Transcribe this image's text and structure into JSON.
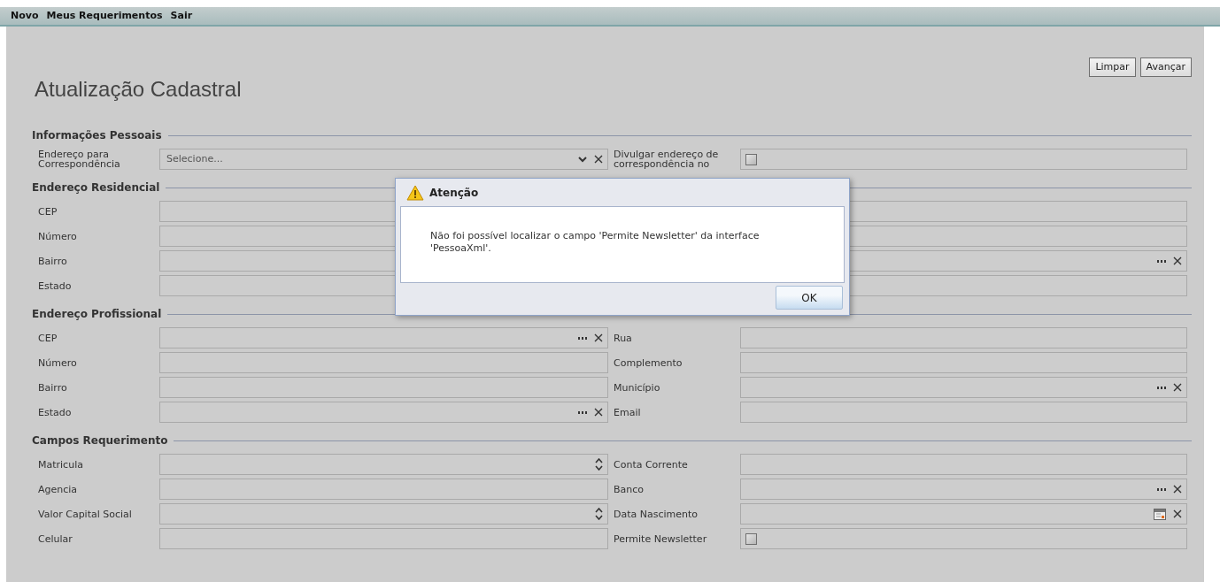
{
  "menu": [
    {
      "label": "Novo"
    },
    {
      "label": "Meus Requerimentos"
    },
    {
      "label": "Sair"
    }
  ],
  "buttons": [
    "Limpar",
    "Avançar"
  ],
  "title": "Atualização Cadastral",
  "sections": [
    {
      "title": "Informações Pessoais",
      "rows": [
        {
          "left": {
            "label": "Endereço para Correspondência",
            "kind": "select",
            "placeholder": "Selecione..."
          },
          "right": {
            "label": "Divulgar endereço de correspondência no",
            "kind": "checkbox",
            "checked": false
          }
        }
      ]
    },
    {
      "title": "Endereço Residencial",
      "rows": [
        {
          "left": {
            "label": "CEP",
            "kind": "text"
          },
          "right": {
            "kind": "text"
          }
        },
        {
          "left": {
            "label": "Número",
            "kind": "text"
          },
          "right": {
            "kind": "text"
          }
        },
        {
          "left": {
            "label": "Bairro",
            "kind": "text"
          },
          "right": {
            "kind": "lookup"
          }
        },
        {
          "left": {
            "label": "Estado",
            "kind": "text"
          },
          "right": {
            "kind": "text"
          }
        }
      ]
    },
    {
      "title": "Endereço Profissional",
      "rows": [
        {
          "left": {
            "label": "CEP",
            "kind": "lookup"
          },
          "right": {
            "label": "Rua",
            "kind": "text"
          }
        },
        {
          "left": {
            "label": "Número",
            "kind": "text"
          },
          "right": {
            "label": "Complemento",
            "kind": "text"
          }
        },
        {
          "left": {
            "label": "Bairro",
            "kind": "text"
          },
          "right": {
            "label": "Município",
            "kind": "lookup"
          }
        },
        {
          "left": {
            "label": "Estado",
            "kind": "lookup"
          },
          "right": {
            "label": "Email",
            "kind": "text"
          }
        }
      ]
    },
    {
      "title": "Campos Requerimento",
      "rows": [
        {
          "left": {
            "label": "Matricula",
            "kind": "spin"
          },
          "right": {
            "label": "Conta Corrente",
            "kind": "text"
          }
        },
        {
          "left": {
            "label": "Agencia",
            "kind": "text"
          },
          "right": {
            "label": "Banco",
            "kind": "lookup"
          }
        },
        {
          "left": {
            "label": "Valor Capital Social",
            "kind": "spin"
          },
          "right": {
            "label": "Data Nascimento",
            "kind": "date"
          }
        },
        {
          "left": {
            "label": "Celular",
            "kind": "text"
          },
          "right": {
            "label": "Permite Newsletter",
            "kind": "checkbox",
            "checked": false
          }
        }
      ]
    }
  ],
  "dialog": {
    "title": "Atenção",
    "message": "Não foi possível localizar o campo 'Permite Newsletter' da interface 'PessoaXml'.",
    "button": "OK"
  }
}
